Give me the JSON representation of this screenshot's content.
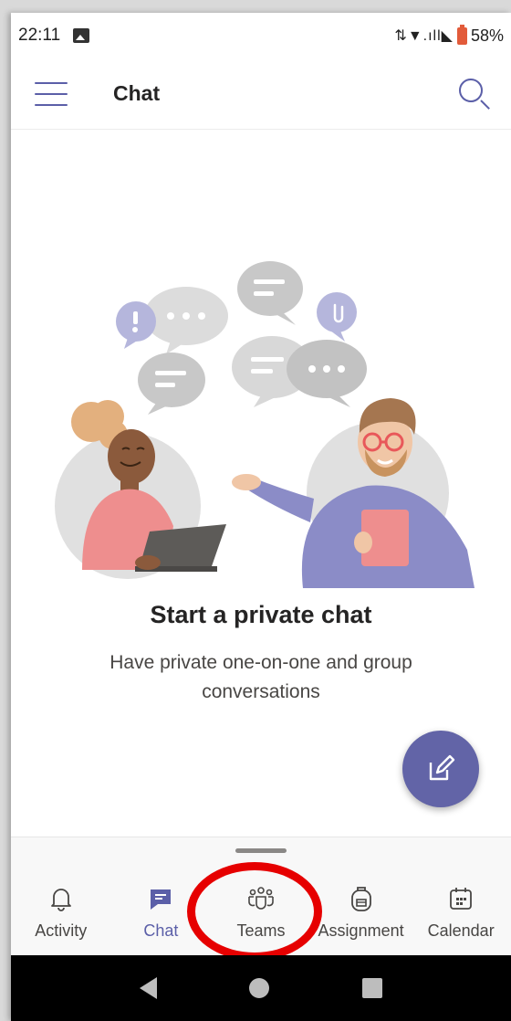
{
  "status_bar": {
    "time": "22:11",
    "battery_percent": "58%",
    "icons": [
      "photo-icon",
      "data-arrows-icon",
      "wifi-icon",
      "signal-icon",
      "no-sim-icon",
      "battery-icon"
    ]
  },
  "header": {
    "title": "Chat",
    "menu_icon": "hamburger-icon",
    "search_icon": "search-icon"
  },
  "empty_state": {
    "title": "Start a private chat",
    "subtitle": "Have private one-on-one and group conversations"
  },
  "fab": {
    "icon": "compose-icon"
  },
  "bottom_nav": {
    "items": [
      {
        "label": "Activity",
        "icon": "bell-icon",
        "active": false
      },
      {
        "label": "Chat",
        "icon": "chat-icon",
        "active": true
      },
      {
        "label": "Teams",
        "icon": "teams-icon",
        "active": false
      },
      {
        "label": "Assignment",
        "icon": "backpack-icon",
        "active": false
      },
      {
        "label": "Calendar",
        "icon": "calendar-icon",
        "active": false
      }
    ]
  },
  "colors": {
    "brand": "#6264a7",
    "brand_dark": "#5b5fa8",
    "annotation": "#e60000"
  }
}
